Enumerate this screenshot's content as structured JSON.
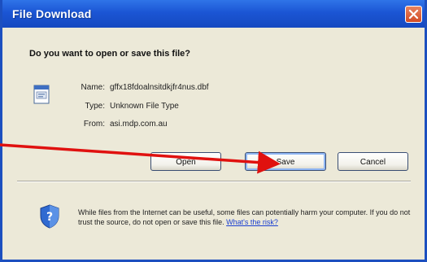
{
  "dialog": {
    "title": "File Download",
    "question": "Do you want to open or save this file?",
    "file": {
      "name_label": "Name:",
      "name_value": "gffx18fdoalnsitdkjfr4nus.dbf",
      "type_label": "Type:",
      "type_value": "Unknown File Type",
      "from_label": "From:",
      "from_value": "asi.mdp.com.au"
    },
    "buttons": {
      "open": "Open",
      "save": "Save",
      "cancel": "Cancel"
    },
    "warning": {
      "text": "While files from the Internet can be useful, some files can potentially harm your computer. If you do not trust the source, do not open or save this file.",
      "link": "What's the risk?"
    }
  },
  "annotation": {
    "arrow_color": "#e0110f",
    "target": "save-button"
  },
  "colors": {
    "titlebar": "#1b55d4",
    "dialog_bg": "#ece9d8",
    "close_button": "#d24a24",
    "link": "#1a3fd1"
  },
  "icons": [
    "close-icon",
    "file-icon",
    "shield-icon"
  ]
}
